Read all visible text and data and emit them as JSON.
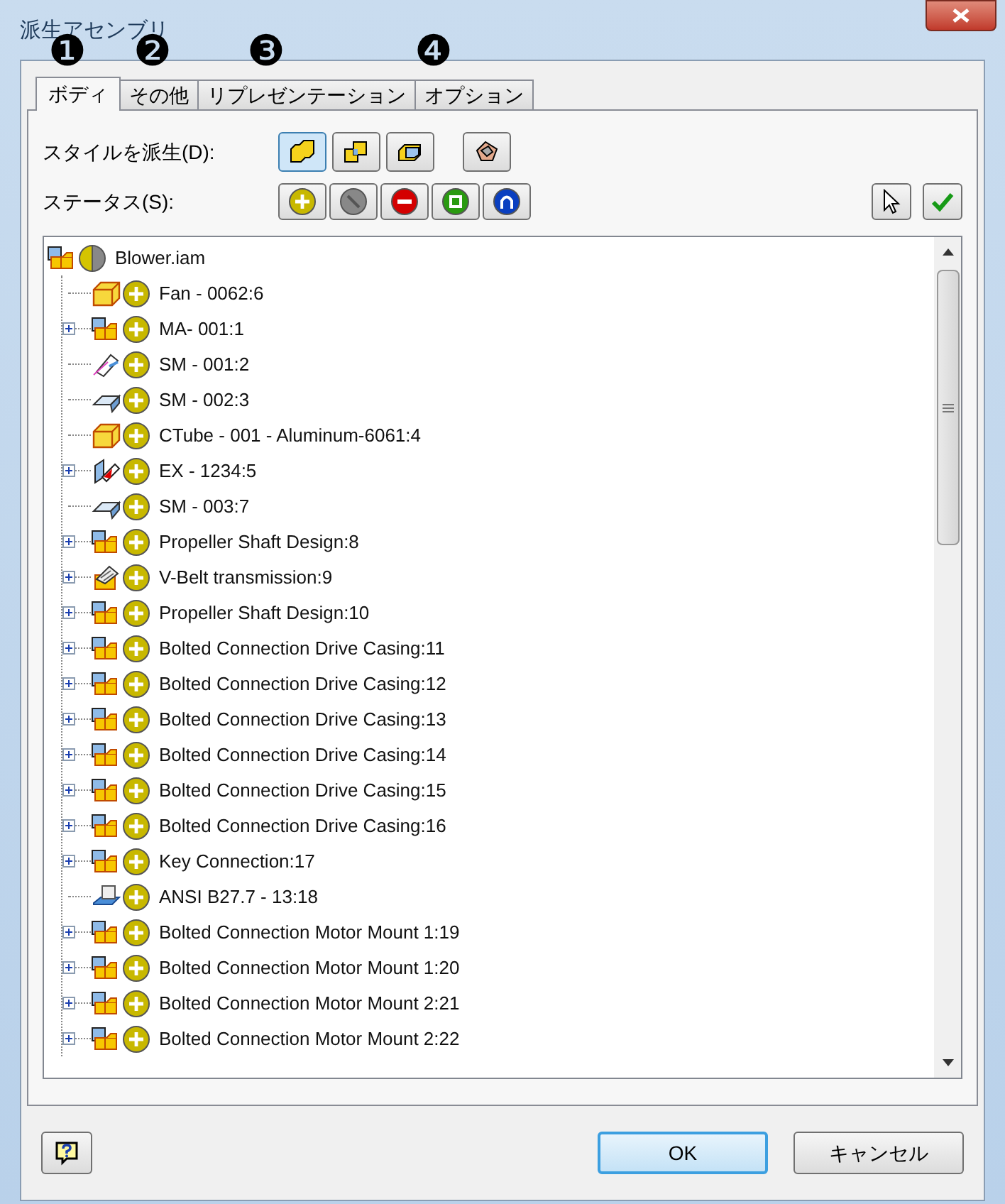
{
  "window": {
    "title": "派生アセンブリ"
  },
  "callouts": [
    "❶",
    "❷",
    "❸",
    "❹"
  ],
  "tabs": [
    {
      "label": "ボディ",
      "selected": true
    },
    {
      "label": "その他",
      "selected": false
    },
    {
      "label": "リプレゼンテーション",
      "selected": false
    },
    {
      "label": "オプション",
      "selected": false
    }
  ],
  "style_row": {
    "label": "スタイルを派生(D):",
    "buttons": [
      {
        "kind": "merge",
        "selected": true
      },
      {
        "kind": "each",
        "selected": false
      },
      {
        "kind": "surface",
        "selected": false
      },
      {
        "kind": "composite",
        "selected": false
      }
    ]
  },
  "status_row": {
    "label": "ステータス(S):",
    "buttons": [
      {
        "kind": "include"
      },
      {
        "kind": "exclude"
      },
      {
        "kind": "subtract"
      },
      {
        "kind": "bounding"
      },
      {
        "kind": "envelope"
      }
    ],
    "tools": [
      {
        "kind": "pick"
      },
      {
        "kind": "apply"
      }
    ]
  },
  "tree": {
    "root": {
      "label": "Blower.iam",
      "kind": "assembly",
      "status": {
        "kind": "mixed"
      },
      "children": [
        {
          "label": "Fan - 0062:6",
          "kind": "part",
          "status": {
            "kind": "include"
          },
          "expandable": false
        },
        {
          "label": "MA- 001:1",
          "kind": "assembly",
          "status": {
            "kind": "include"
          },
          "expandable": true
        },
        {
          "label": "SM - 001:2",
          "kind": "flat",
          "status": {
            "kind": "include"
          },
          "expandable": false
        },
        {
          "label": "SM - 002:3",
          "kind": "sheet",
          "status": {
            "kind": "include"
          },
          "expandable": false
        },
        {
          "label": "CTube - 001 - Aluminum-6061:4",
          "kind": "part",
          "status": {
            "kind": "include"
          },
          "expandable": false
        },
        {
          "label": "EX - 1234:5",
          "kind": "weldment",
          "status": {
            "kind": "include"
          },
          "expandable": true
        },
        {
          "label": "SM - 003:7",
          "kind": "sheet",
          "status": {
            "kind": "include"
          },
          "expandable": false
        },
        {
          "label": "Propeller Shaft Design:8",
          "kind": "assembly",
          "status": {
            "kind": "include"
          },
          "expandable": true
        },
        {
          "label": "V-Belt transmission:9",
          "kind": "generator",
          "status": {
            "kind": "include"
          },
          "expandable": true
        },
        {
          "label": "Propeller Shaft Design:10",
          "kind": "assembly",
          "status": {
            "kind": "include"
          },
          "expandable": true
        },
        {
          "label": "Bolted Connection Drive Casing:11",
          "kind": "assembly",
          "status": {
            "kind": "include"
          },
          "expandable": true
        },
        {
          "label": "Bolted Connection Drive Casing:12",
          "kind": "assembly",
          "status": {
            "kind": "include"
          },
          "expandable": true
        },
        {
          "label": "Bolted Connection Drive Casing:13",
          "kind": "assembly",
          "status": {
            "kind": "include"
          },
          "expandable": true
        },
        {
          "label": "Bolted Connection Drive Casing:14",
          "kind": "assembly",
          "status": {
            "kind": "include"
          },
          "expandable": true
        },
        {
          "label": "Bolted Connection Drive Casing:15",
          "kind": "assembly",
          "status": {
            "kind": "include"
          },
          "expandable": true
        },
        {
          "label": "Bolted Connection Drive Casing:16",
          "kind": "assembly",
          "status": {
            "kind": "include"
          },
          "expandable": true
        },
        {
          "label": "Key Connection:17",
          "kind": "assembly",
          "status": {
            "kind": "include"
          },
          "expandable": true
        },
        {
          "label": "ANSI B27.7 - 13:18",
          "kind": "library",
          "status": {
            "kind": "include"
          },
          "expandable": false
        },
        {
          "label": "Bolted Connection Motor Mount 1:19",
          "kind": "assembly",
          "status": {
            "kind": "include"
          },
          "expandable": true
        },
        {
          "label": "Bolted Connection Motor Mount 1:20",
          "kind": "assembly",
          "status": {
            "kind": "include"
          },
          "expandable": true
        },
        {
          "label": "Bolted Connection Motor Mount 2:21",
          "kind": "assembly",
          "status": {
            "kind": "include"
          },
          "expandable": true
        },
        {
          "label": "Bolted Connection Motor Mount 2:22",
          "kind": "assembly",
          "status": {
            "kind": "include"
          },
          "expandable": true
        }
      ]
    }
  },
  "footer": {
    "ok": {
      "label": "OK",
      "default": true
    },
    "cancel": {
      "label": "キャンセル",
      "default": false
    }
  }
}
